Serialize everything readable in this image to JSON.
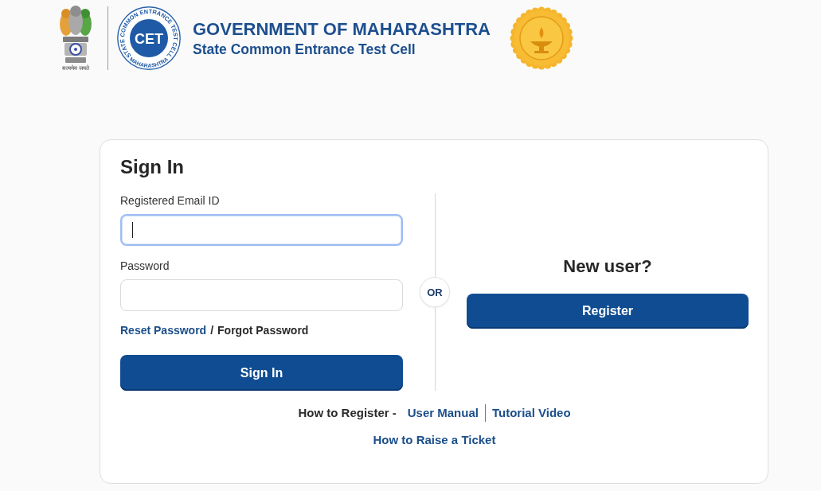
{
  "header": {
    "emblem": {
      "motto": "सत्यमेव जयते"
    },
    "cet_logo": {
      "ring_text_top": "STATE COMMON ENTRANCE TEST CELL",
      "ring_text_bottom": "MAHARASHTRA",
      "initials": "CET"
    },
    "title": "GOVERNMENT OF MAHARASHTRA",
    "subtitle": "State Common Entrance Test Cell"
  },
  "sign_in": {
    "heading": "Sign In",
    "fields": [
      {
        "label": "Registered Email ID",
        "focused": true
      },
      {
        "label": "Password",
        "focused": false
      }
    ],
    "reset_link": "Reset Password",
    "separator": "/",
    "forgot_link": "Forgot Password",
    "button": "Sign In"
  },
  "divider_badge": "OR",
  "new_user": {
    "heading": "New user?",
    "button": "Register"
  },
  "help": {
    "prefix": "How to Register -",
    "links": [
      "User Manual",
      "Tutorial Video"
    ],
    "ticket_link": "How to Raise a Ticket"
  }
}
